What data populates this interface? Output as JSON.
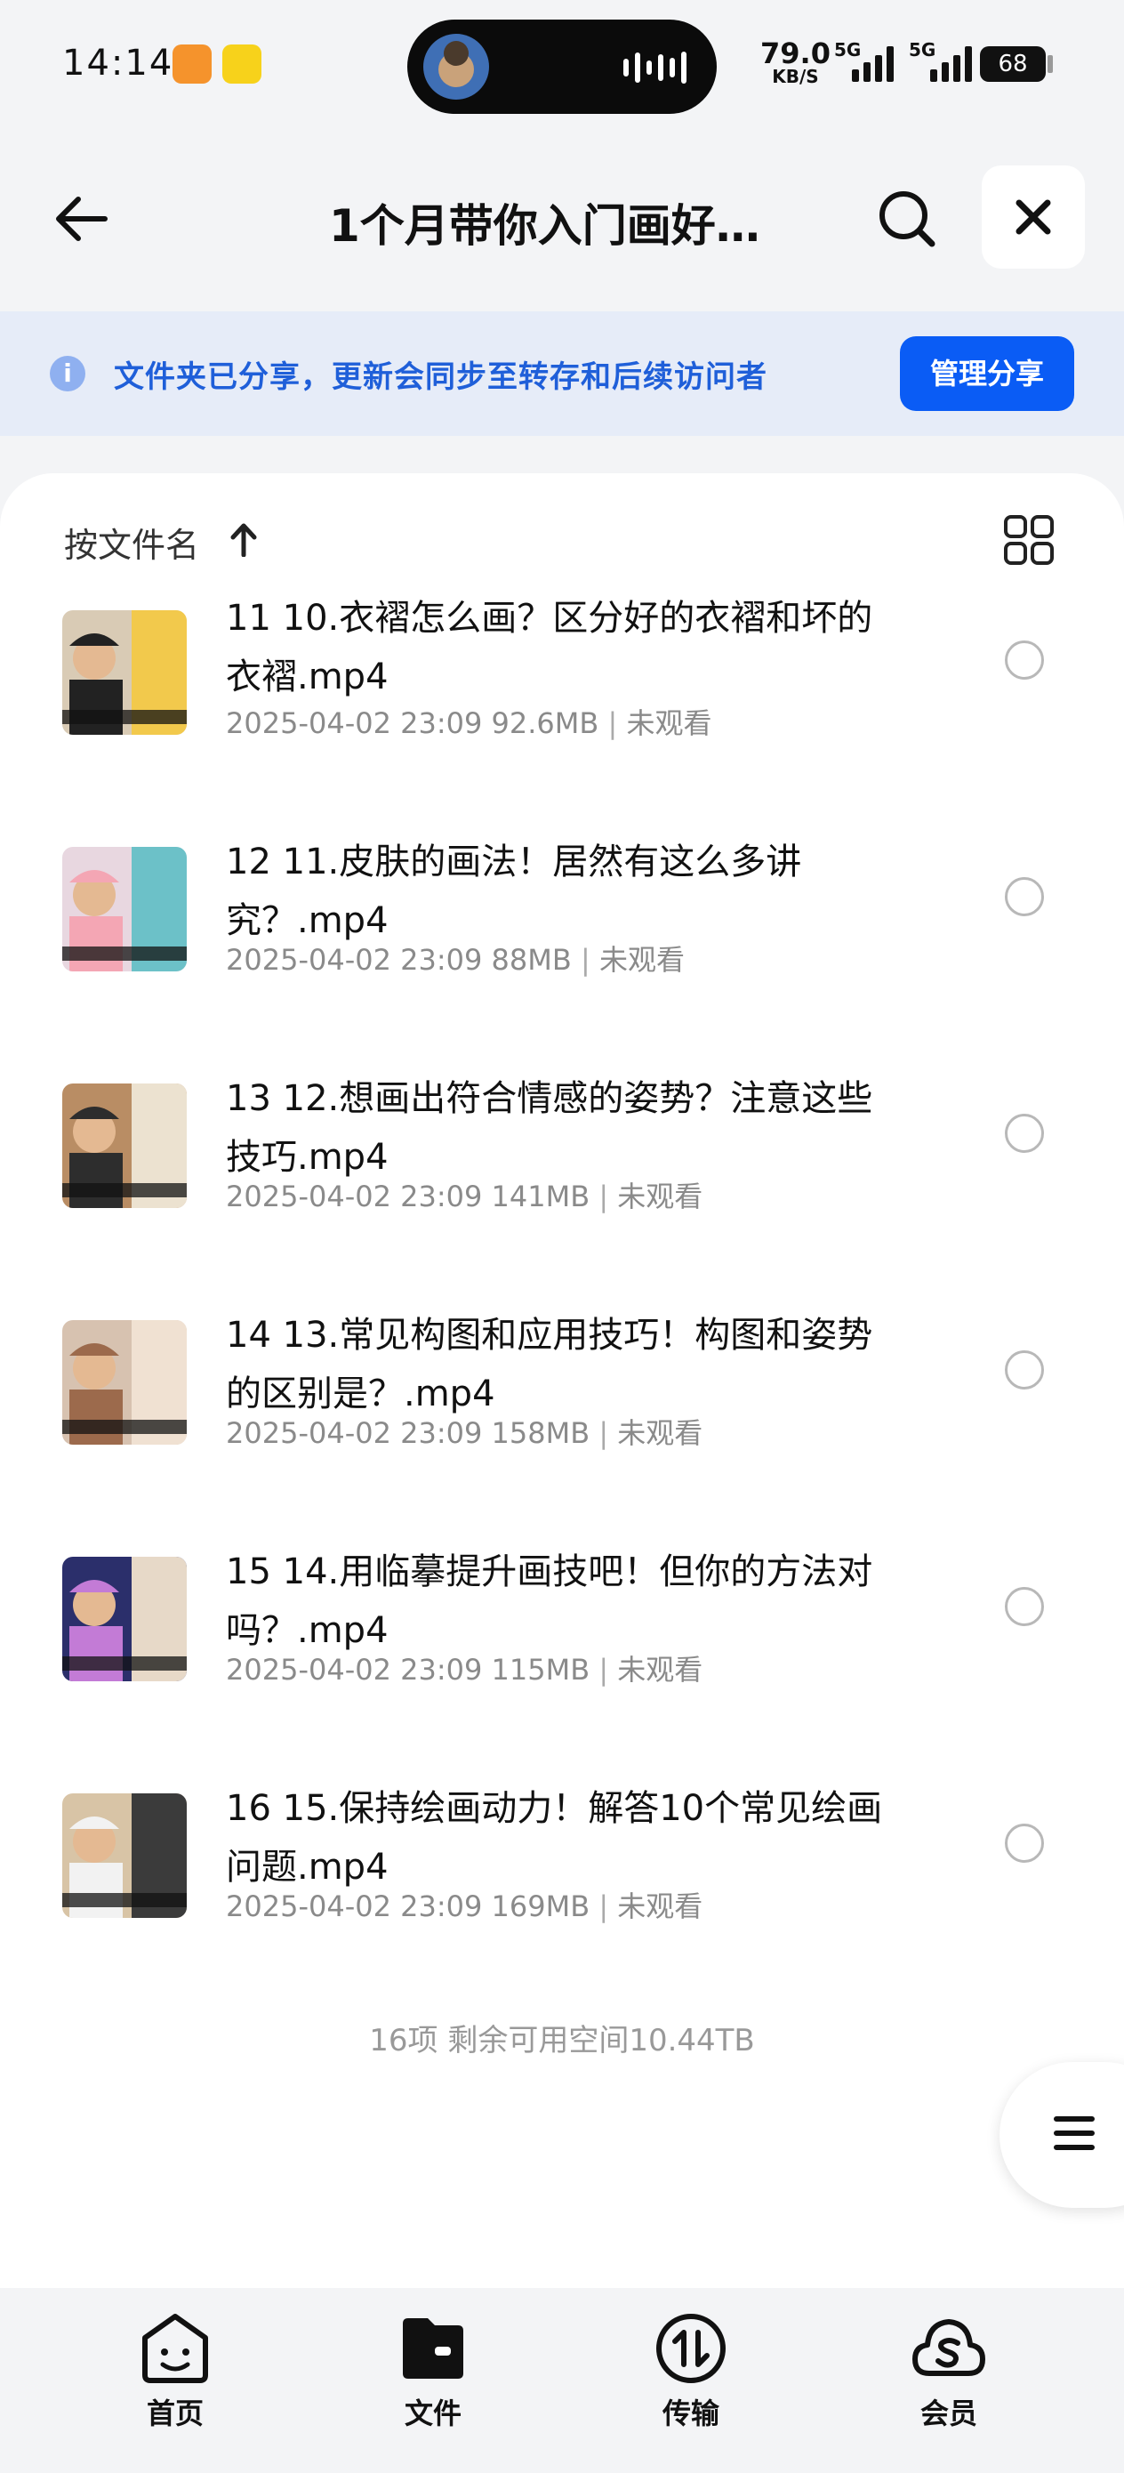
{
  "status_bar": {
    "time": "14:14",
    "network_speed": "79.0",
    "network_unit": "KB/S",
    "signal_1_label": "5G",
    "signal_2_label": "5G",
    "battery": "68"
  },
  "header": {
    "title": "1个月带你入门画好…"
  },
  "banner": {
    "text": "文件夹已分享，更新会同步至转存和后续访问者",
    "manage_label": "管理分享"
  },
  "sort": {
    "label": "按文件名"
  },
  "files": [
    {
      "name": "11 10.衣褶怎么画？区分好的衣褶和坏的衣褶.mp4",
      "date": "2025-04-02 23:09",
      "size": "92.6MB",
      "status": "未观看",
      "thumb_colors": [
        "#d9cbb5",
        "#222",
        "#f2c94c"
      ]
    },
    {
      "name": "12 11.皮肤的画法！居然有这么多讲究？.mp4",
      "date": "2025-04-02 23:09",
      "size": "88MB",
      "status": "未观看",
      "thumb_colors": [
        "#e8d7e0",
        "#f4a6b4",
        "#6cc1c8"
      ]
    },
    {
      "name": "13 12.想画出符合情感的姿势？注意这些技巧.mp4",
      "date": "2025-04-02 23:09",
      "size": "141MB",
      "status": "未观看",
      "thumb_colors": [
        "#b98d64",
        "#2d2d2d",
        "#ece2d0"
      ]
    },
    {
      "name": "14 13.常见构图和应用技巧！构图和姿势的区别是？.mp4",
      "date": "2025-04-02 23:09",
      "size": "158MB",
      "status": "未观看",
      "thumb_colors": [
        "#d7c2b0",
        "#9c6a4c",
        "#f0e1d2"
      ]
    },
    {
      "name": "15 14.用临摹提升画技吧！但你的方法对吗？.mp4",
      "date": "2025-04-02 23:09",
      "size": "115MB",
      "status": "未观看",
      "thumb_colors": [
        "#2b2f6b",
        "#c37bd6",
        "#e7d9c8"
      ]
    },
    {
      "name": "16 15.保持绘画动力！解答10个常见绘画问题.mp4",
      "date": "2025-04-02 23:09",
      "size": "169MB",
      "status": "未观看",
      "thumb_colors": [
        "#d8c4a6",
        "#f2f2f2",
        "#3b3b3b"
      ]
    }
  ],
  "footer": {
    "summary": "16项 剩余可用空间10.44TB"
  },
  "bottom_nav": {
    "home": "首页",
    "files": "文件",
    "transfer": "传输",
    "vip": "会员"
  },
  "colors": {
    "accent": "#0a5cf5",
    "banner_bg": "#e6ecf8",
    "banner_text": "#1f5fd9"
  }
}
